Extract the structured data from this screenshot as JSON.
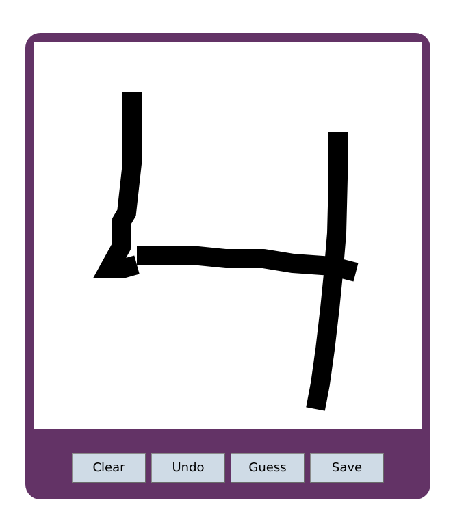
{
  "colors": {
    "frame": "#633366",
    "canvas_background": "#ffffff",
    "stroke": "#000000",
    "button_background": "#cfdbe6"
  },
  "toolbar": {
    "clear_label": "Clear",
    "undo_label": "Undo",
    "guess_label": "Guess",
    "save_label": "Save"
  }
}
